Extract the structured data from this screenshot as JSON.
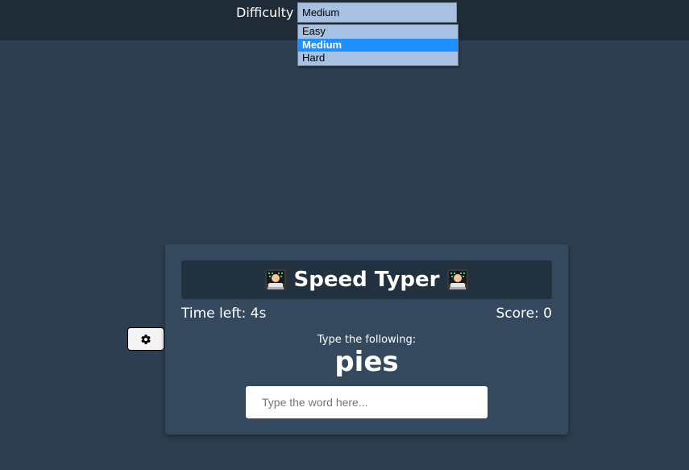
{
  "header": {
    "difficulty_label": "Difficulty",
    "difficulty_selected": "Medium",
    "difficulty_options": [
      "Easy",
      "Medium",
      "Hard"
    ]
  },
  "settings": {
    "icon": "gear-icon"
  },
  "game": {
    "title": "Speed Typer",
    "title_icon": "technologist-emoji",
    "time_left": "Time left: 4s",
    "score": "Score: 0",
    "prompt": "Type the following:",
    "word": "pies",
    "input_placeholder": "Type the word here...",
    "input_value": ""
  },
  "colors": {
    "background": "#2c3e50",
    "topbar": "#202b38",
    "card": "#34495e",
    "title_bar": "#223140",
    "select_bg": "#a6c1e2",
    "option_highlight": "#1e90ff"
  }
}
